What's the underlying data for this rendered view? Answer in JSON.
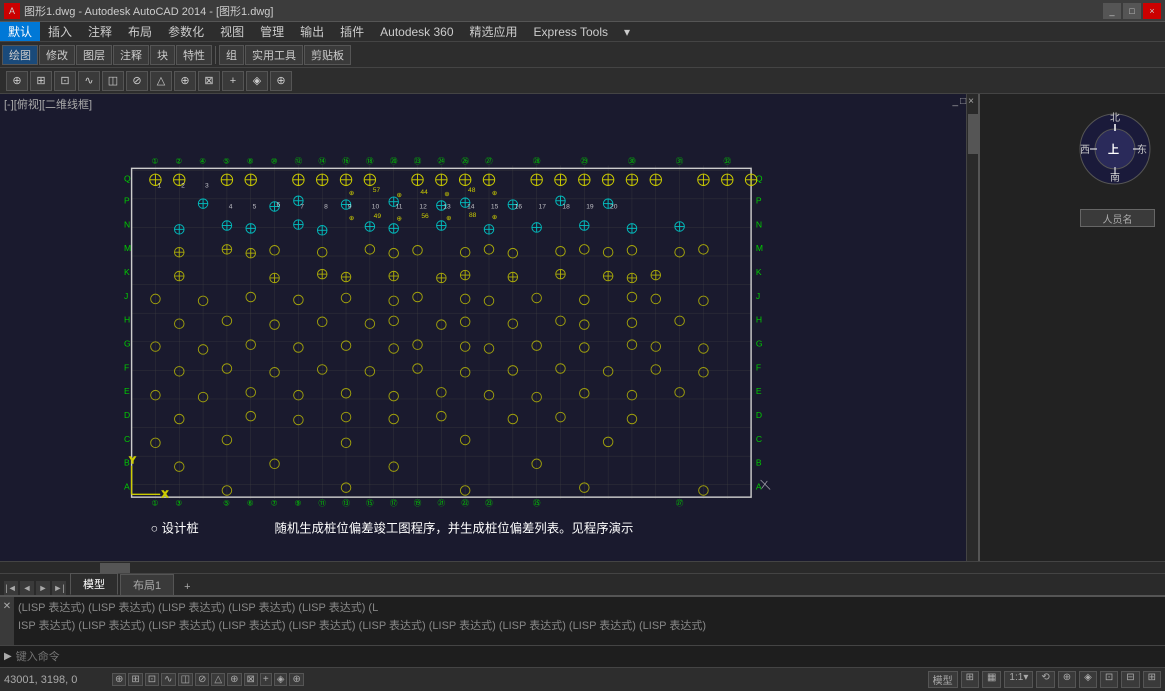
{
  "titlebar": {
    "title": "图形1.dwg - Autodesk AutoCAD 2014 - [图形1.dwg]",
    "min_label": "_",
    "max_label": "□",
    "close_label": "×"
  },
  "menubar": {
    "items": [
      "默认",
      "插入",
      "注释",
      "布局",
      "参数化",
      "视图",
      "管理",
      "输出",
      "插件",
      "Autodesk 360",
      "精选应用",
      "Express Tools",
      "▾"
    ]
  },
  "toolbar": {
    "row1": [
      "绘图",
      "修改",
      "图层",
      "注释",
      "块",
      "特性",
      "✕",
      "组",
      "实用工具",
      "剪贴板"
    ],
    "row2_icons": [
      "⊕",
      "⊞",
      "⊡",
      "∿",
      "◫",
      "⊘",
      "△",
      "⊕",
      "⊠",
      "+",
      "◈",
      "⊕"
    ]
  },
  "viewport": {
    "label": "[-][俯视][二维线框]",
    "bg_color": "#1a1a2e"
  },
  "compass": {
    "north": "北",
    "south": "南",
    "east": "东",
    "west": "西",
    "up": "上"
  },
  "user": {
    "name_placeholder": "人员名"
  },
  "legend": {
    "circle_label": "○ 设计桩",
    "description": "随机生成桩位偏差竣工图程序，并生成桩位偏差列表。见程序演示"
  },
  "tabs": {
    "model_label": "模型",
    "layout_label": "布局1"
  },
  "commandline": {
    "line1": "(LISP 表达式) (LISP 表达式) (LISP 表达式) (LISP 表达式) (LISP 表达式) (L",
    "line2": "ISP 表达式) (LISP 表达式) (LISP 表达式) (LISP 表达式) (LISP 表达式) (LISP 表达式) (LISP 表达式) (LISP 表达式) (LISP 表达式) (LISP 表达式)",
    "input_placeholder": "键入命令"
  },
  "statusbar": {
    "coords": "43001, 3198, 0",
    "buttons": [
      "模型",
      "⊞",
      "▦",
      "✱",
      "1:1▾",
      "⟲",
      "⊕",
      "◈",
      "⊡",
      "⊟",
      "⊞"
    ],
    "scale": "1:1▾"
  },
  "colors": {
    "bg": "#1a1a2e",
    "grid_green": "#00cc00",
    "grid_yellow": "#cccc00",
    "grid_cyan": "#00cccc",
    "white": "#ffffff",
    "label_green": "#00ff00",
    "line_white": "#cccccc"
  }
}
